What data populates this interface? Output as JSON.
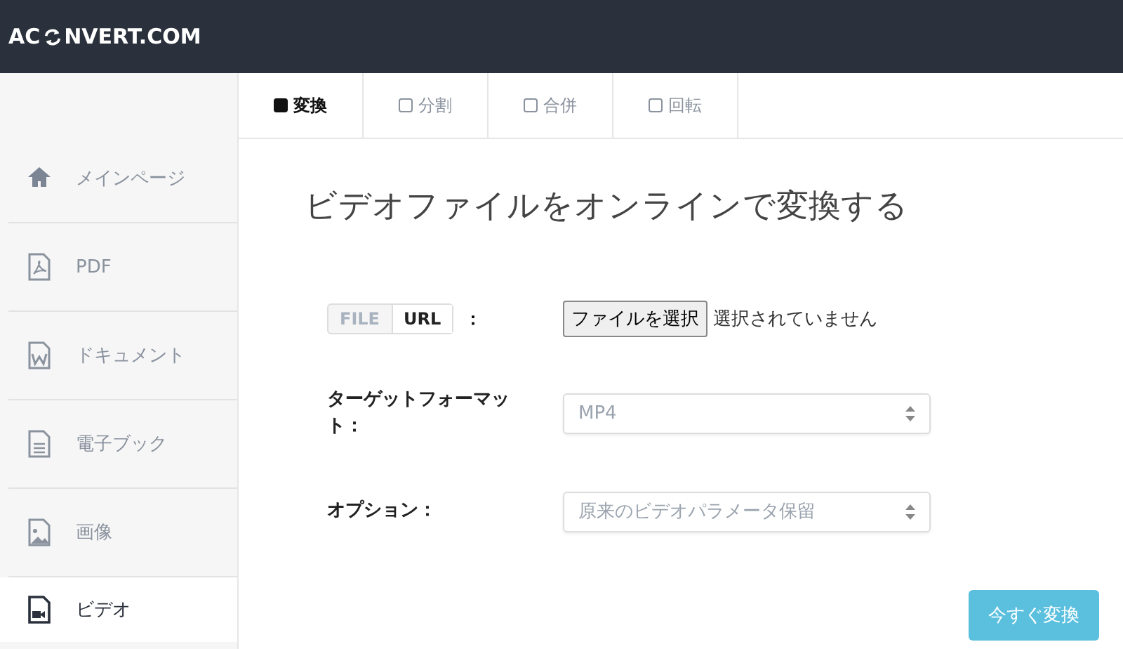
{
  "header": {
    "logo_before": "AC",
    "logo_after": "NVERT.COM"
  },
  "sidebar": {
    "items": [
      {
        "label": "メインページ",
        "kind": "home",
        "selected": false
      },
      {
        "label": "PDF",
        "kind": "pdf",
        "selected": false
      },
      {
        "label": "ドキュメント",
        "kind": "doc",
        "selected": false
      },
      {
        "label": "電子ブック",
        "kind": "ebook",
        "selected": false
      },
      {
        "label": "画像",
        "kind": "image",
        "selected": false
      },
      {
        "label": "ビデオ",
        "kind": "video",
        "selected": true
      }
    ]
  },
  "tabs": [
    {
      "label": "変換",
      "selected": true
    },
    {
      "label": "分割",
      "selected": false
    },
    {
      "label": "合併",
      "selected": false
    },
    {
      "label": "回転",
      "selected": false
    }
  ],
  "title": "ビデオファイルをオンラインで変換する",
  "form": {
    "source_toggle": [
      {
        "label": "FILE",
        "selected": false
      },
      {
        "label": "URL",
        "selected": true
      }
    ],
    "source_colon": "：",
    "file_button": "ファイルを選択",
    "file_status": "選択されていません",
    "target_label": "ターゲットフォーマット：",
    "target_value": "MP4",
    "option_label": "オプション：",
    "option_value": "原来のビデオパラメータ保留"
  },
  "convert_button": "今すぐ変換"
}
